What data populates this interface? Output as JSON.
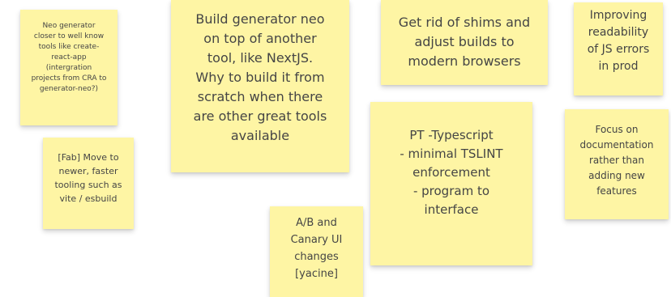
{
  "board": {
    "note_color": "#fef5a4",
    "notes": [
      {
        "text": "Neo generator\ncloser to well know\ntools like create-\nreact-app\n(intergration\nprojects from CRA to\ngenerator-neo?)"
      },
      {
        "text": "[Fab] Move to\nnewer, faster\ntooling such as\nvite / esbuild"
      },
      {
        "text": "Build generator neo\non top of another\ntool, like NextJS.\nWhy to build it from\nscratch when there\nare other great tools\navailable"
      },
      {
        "text": "Get rid of shims and\nadjust builds to\nmodern browsers"
      },
      {
        "text": "Improving\nreadability\nof JS errors\nin prod"
      },
      {
        "text": "Focus on\ndocumentation\nrather than\nadding new\nfeatures"
      },
      {
        "text": "PT -Typescript\n- minimal TSLINT\nenforcement\n- program to\ninterface"
      },
      {
        "text": "A/B and\nCanary UI\nchanges\n[yacine]"
      }
    ]
  }
}
